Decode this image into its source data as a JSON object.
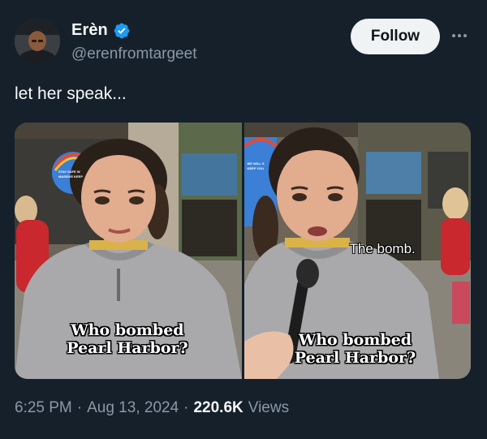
{
  "author": {
    "display_name": "Erèn",
    "handle": "@erenfromtargeet",
    "verified": true,
    "avatar_icon": "profile-photo-icon"
  },
  "header": {
    "follow_label": "Follow",
    "more_icon": "more-horizontal-icon"
  },
  "tweet": {
    "text": "let her speak..."
  },
  "media": {
    "frames": [
      {
        "caption_line1": "Who bombed",
        "caption_line2": "Pearl Harbor?",
        "sign_line1": "STAY SAFE W",
        "sign_line2": "MASSIVE KEEP"
      },
      {
        "caption_line1": "Who bombed",
        "caption_line2": "Pearl Harbor?",
        "subtitle": "The bomb.",
        "sign_line1": "WE WILL S",
        "sign_line2": "KEEP YOU"
      }
    ]
  },
  "footer": {
    "time": "6:25 PM",
    "date": "Aug 13, 2024",
    "views_count": "220.6K",
    "views_label": "Views",
    "separator": "·"
  },
  "colors": {
    "background": "#15202b",
    "verified_blue": "#1d9bf0",
    "secondary_text": "#8b98a5",
    "primary_text": "#f7f9f9"
  }
}
